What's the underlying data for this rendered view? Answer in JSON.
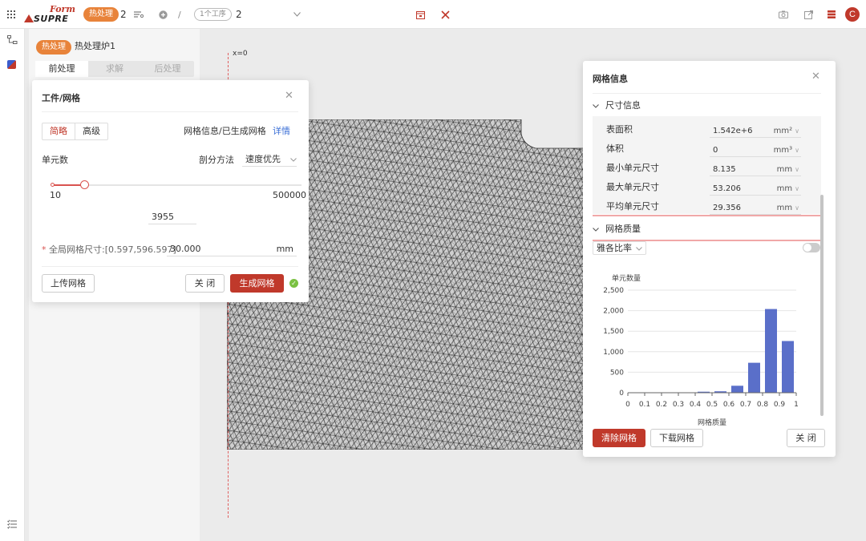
{
  "topbar": {
    "badge": "热处理",
    "count": "2",
    "step_badge": "1个工序",
    "step_count": "2",
    "divider": "/",
    "avatar_letter": "C"
  },
  "left_panel": {
    "badge": "热处理",
    "title": "热处理炉1",
    "tabs": [
      {
        "label": "前处理",
        "active": true
      },
      {
        "label": "求解",
        "active": false
      },
      {
        "label": "后处理",
        "active": false
      }
    ]
  },
  "mesh_dialog": {
    "title": "工件/网格",
    "mode_tabs": [
      "简略",
      "高级"
    ],
    "mesh_status": "网格信息/已生成网格",
    "detail_link": "详情",
    "element_count_label": "单元数",
    "method_label": "剖分方法",
    "method_value": "速度优先",
    "slider_min": "10",
    "slider_max": "500000",
    "slider_fraction": 0.13,
    "element_count_value": "3955",
    "global_size_label": "全局网格尺寸:[0.597,596.597]",
    "required_mark": "*",
    "global_size_value": "30.000",
    "global_size_unit": "mm",
    "upload_button": "上传网格",
    "close_button": "关 闭",
    "generate_button": "生成网格"
  },
  "viewport": {
    "axis_label": "x=0"
  },
  "info_dialog": {
    "title": "网格信息",
    "size_section": "尺寸信息",
    "rows": [
      {
        "label": "表面积",
        "value": "1.542e+6",
        "unit": "mm²"
      },
      {
        "label": "体积",
        "value": "0",
        "unit": "mm³"
      },
      {
        "label": "最小单元尺寸",
        "value": "8.135",
        "unit": "mm"
      },
      {
        "label": "最大单元尺寸",
        "value": "53.206",
        "unit": "mm"
      },
      {
        "label": "平均单元尺寸",
        "value": "29.356",
        "unit": "mm"
      }
    ],
    "quality_section": "网格质量",
    "quality_metric": "雅各比率",
    "clear_button": "清除网格",
    "download_button": "下载网格",
    "close_button": "关 闭"
  },
  "chart_data": {
    "type": "bar",
    "ylabel": "单元数量",
    "xlabel": "网格质量",
    "x_ticks": [
      "0",
      "0.1",
      "0.2",
      "0.3",
      "0.4",
      "0.5",
      "0.6",
      "0.7",
      "0.8",
      "0.9",
      "1"
    ],
    "y_ticks": [
      "0",
      "500",
      "1,000",
      "1,500",
      "2,000",
      "2,500"
    ],
    "ylim": [
      0,
      2500
    ],
    "bins": [
      {
        "start": 0.3,
        "end": 0.4,
        "value": 5
      },
      {
        "start": 0.4,
        "end": 0.5,
        "value": 25
      },
      {
        "start": 0.5,
        "end": 0.6,
        "value": 35
      },
      {
        "start": 0.6,
        "end": 0.7,
        "value": 170
      },
      {
        "start": 0.7,
        "end": 0.8,
        "value": 730
      },
      {
        "start": 0.8,
        "end": 0.9,
        "value": 2040
      },
      {
        "start": 0.9,
        "end": 1.0,
        "value": 1260
      }
    ],
    "bar_color": "#5a6fc9"
  }
}
